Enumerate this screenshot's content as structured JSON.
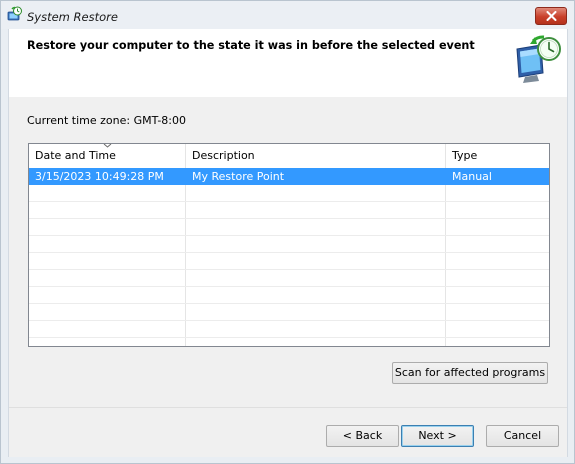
{
  "window": {
    "title": "System Restore",
    "close_icon": "close-icon"
  },
  "header": {
    "heading": "Restore your computer to the state it was in before the selected event",
    "icon": "system-restore-icon"
  },
  "timezone": "Current time zone: GMT-8:00",
  "table": {
    "columns": [
      "Date and Time",
      "Description",
      "Type"
    ],
    "sort_column": "Date and Time",
    "rows": [
      {
        "date": "3/15/2023 10:49:28 PM",
        "description": "My Restore Point",
        "type": "Manual",
        "selected": true
      }
    ]
  },
  "buttons": {
    "scan": "Scan for affected programs",
    "back": "< Back",
    "next": "Next >",
    "cancel": "Cancel"
  },
  "colors": {
    "selection": "#3399ff",
    "close_button": "#c9402a"
  }
}
